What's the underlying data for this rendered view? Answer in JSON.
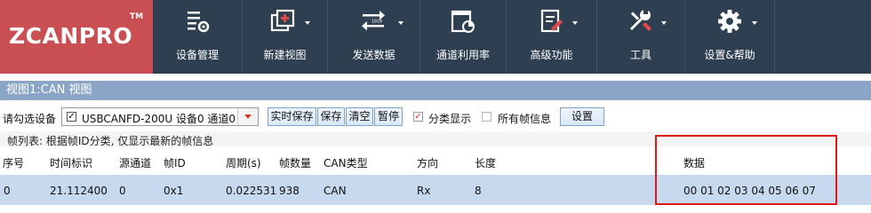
{
  "app": {
    "logo_text": "ZCANPRO",
    "logo_mark": "TM"
  },
  "toolbar": {
    "items": [
      {
        "label": "设备管理",
        "icon": "device-manage-icon",
        "has_menu": false
      },
      {
        "label": "新建视图",
        "icon": "new-view-icon",
        "has_menu": true
      },
      {
        "label": "发送数据",
        "icon": "send-data-icon",
        "has_menu": true
      },
      {
        "label": "通道利用率",
        "icon": "channel-usage-icon",
        "has_menu": false
      },
      {
        "label": "高级功能",
        "icon": "advanced-icon",
        "has_menu": true
      },
      {
        "label": "工具",
        "icon": "tools-icon",
        "has_menu": true
      },
      {
        "label": "设置&帮助",
        "icon": "settings-help-icon",
        "has_menu": true
      }
    ]
  },
  "view": {
    "title": "视图1:CAN 视图"
  },
  "device_bar": {
    "select_label": "请勾选设备",
    "device_checked": true,
    "device_value": "USBCANFD-200U 设备0 通道0",
    "realtime_save": "实时保存",
    "save": "保存",
    "clear": "清空",
    "pause": "暂停",
    "classify_label": "分类显示",
    "classify_checked": true,
    "all_frames_label": "所有帧信息",
    "all_frames_checked": false,
    "settings": "设置"
  },
  "info_text": "帧列表: 根据帧ID分类, 仅显示最新的帧信息",
  "table": {
    "columns": [
      "序号",
      "时间标识",
      "源通道",
      "帧ID",
      "周期(s)",
      "帧数量",
      "CAN类型",
      "方向",
      "长度",
      "数据"
    ],
    "rows": [
      [
        "0",
        "21.112400",
        "0",
        "0x1",
        "0.022531",
        "938",
        "CAN",
        "Rx",
        "8",
        "00 01 02 03 04 05 06 07"
      ]
    ]
  },
  "colors": {
    "toolbar_bg": "#2e3f52",
    "logo_bg": "#c94f52",
    "view_title_bg": "#8aa5c5",
    "row_selected_bg": "#c7d9ee",
    "highlight_border": "#e01818"
  }
}
